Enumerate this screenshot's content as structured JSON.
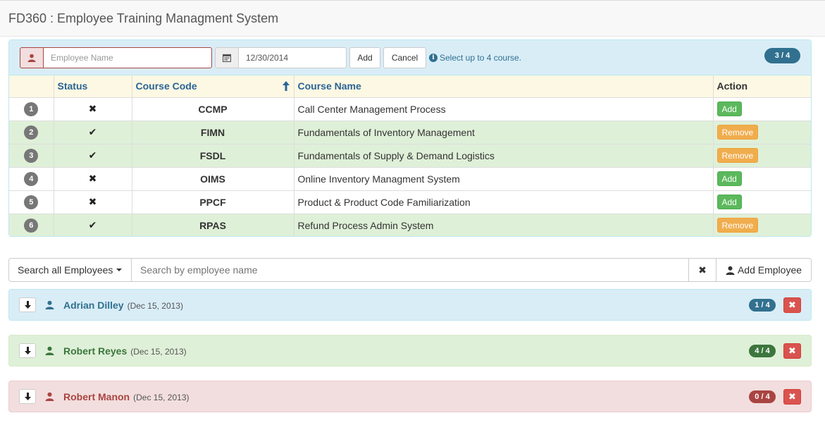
{
  "app": {
    "title": "FD360 : Employee Training Managment System"
  },
  "enroll": {
    "employee_placeholder": "Employee Name",
    "date_value": "12/30/2014",
    "add_label": "Add",
    "cancel_label": "Cancel",
    "info_text": "Select up to 4 course.",
    "count_badge": "3 / 4"
  },
  "table": {
    "headers": {
      "status": "Status",
      "code": "Course Code",
      "name": "Course Name",
      "action": "Action"
    },
    "rows": [
      {
        "num": "1",
        "status": "not-enrolled",
        "status_glyph": "✖",
        "code": "CCMP",
        "name": "Call Center Management Process",
        "action": "Add"
      },
      {
        "num": "2",
        "status": "enrolled",
        "status_glyph": "✔",
        "code": "FIMN",
        "name": "Fundamentals of Inventory Management",
        "action": "Remove"
      },
      {
        "num": "3",
        "status": "enrolled",
        "status_glyph": "✔",
        "code": "FSDL",
        "name": "Fundamentals of Supply & Demand Logistics",
        "action": "Remove"
      },
      {
        "num": "4",
        "status": "not-enrolled",
        "status_glyph": "✖",
        "code": "OIMS",
        "name": "Online Inventory Managment System",
        "action": "Add"
      },
      {
        "num": "5",
        "status": "not-enrolled",
        "status_glyph": "✖",
        "code": "PPCF",
        "name": "Product & Product Code Familiarization",
        "action": "Add"
      },
      {
        "num": "6",
        "status": "enrolled",
        "status_glyph": "✔",
        "code": "RPAS",
        "name": "Refund Process Admin System",
        "action": "Remove"
      }
    ]
  },
  "search": {
    "scope_label": "Search all Employees",
    "placeholder": "Search by employee name",
    "add_employee_label": "Add Employee"
  },
  "employees": [
    {
      "name": "Adrian Dilley",
      "date": "(Dec 15, 2013)",
      "count": "1 / 4",
      "state": "info"
    },
    {
      "name": "Robert Reyes",
      "date": "(Dec 15, 2013)",
      "count": "4 / 4",
      "state": "success"
    },
    {
      "name": "Robert Manon",
      "date": "(Dec 15, 2013)",
      "count": "0 / 4",
      "state": "danger"
    }
  ],
  "colors": {
    "info_text": "#31708f",
    "success_text": "#3c763d",
    "danger_text": "#a94442",
    "add_button": "#5cb85c",
    "remove_button": "#f0ad4e",
    "delete_button": "#d9534f"
  },
  "icons": [
    "user-icon",
    "calendar-icon",
    "info-icon",
    "sort-asc-icon",
    "check-icon",
    "cross-icon",
    "caret-down-icon",
    "clear-icon",
    "expand-down-icon",
    "delete-icon"
  ]
}
